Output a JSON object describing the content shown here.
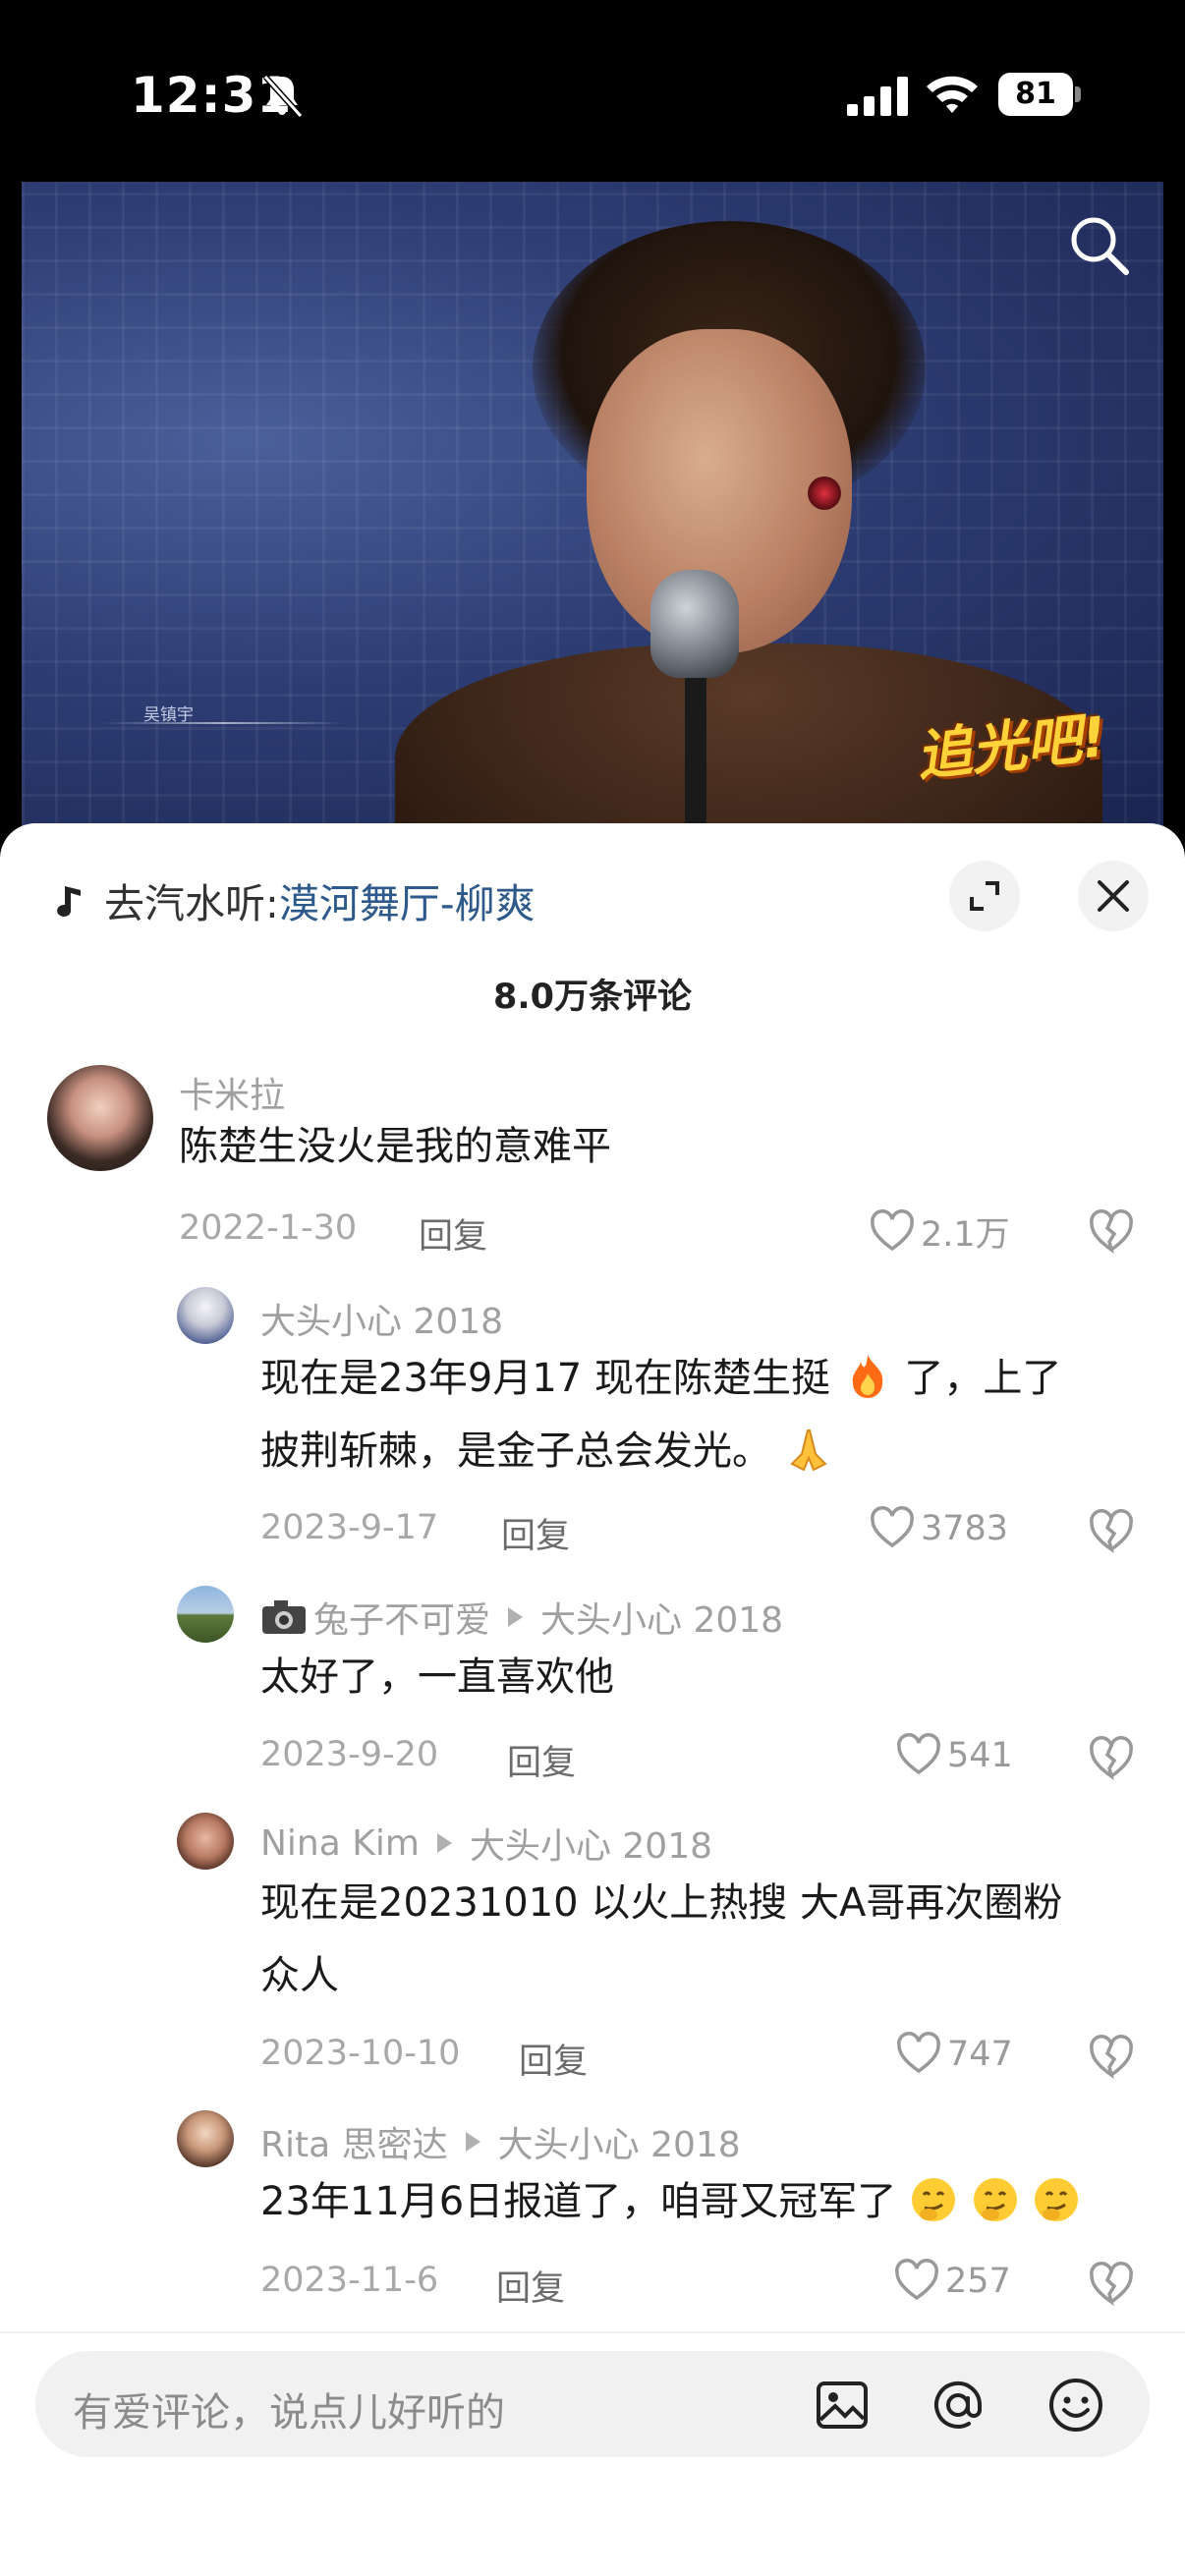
{
  "status_bar": {
    "time": "12:31",
    "battery": "81"
  },
  "video": {
    "name_tag": "吴镇宇",
    "logo_text": "追光吧!"
  },
  "sheet": {
    "music_prefix": "去汽水听:",
    "music_song": "漠河舞厅-柳爽",
    "comment_count": "8.0万条评论"
  },
  "comments": [
    {
      "user": "卡米拉",
      "text_lines": [
        "陈楚生没火是我的意难平"
      ],
      "date": "2022-1-30",
      "reply": "回复",
      "likes": "2.1万"
    },
    {
      "user": "大头小心 2018",
      "text_lines": [
        "现在是23年9月17 现在陈楚生挺",
        "了，上了",
        "披荆斩棘，是金子总会发光。"
      ],
      "date": "2023-9-17",
      "reply": "回复",
      "likes": "3783"
    },
    {
      "user": "兔子不可爱",
      "reply_to": "大头小心 2018",
      "text_lines": [
        "太好了，一直喜欢他"
      ],
      "date": "2023-9-20",
      "reply": "回复",
      "likes": "541"
    },
    {
      "user": "Nina Kim",
      "reply_to": "大头小心 2018",
      "text_lines": [
        "现在是20231010 以火上热搜 大A哥再次圈粉",
        "众人"
      ],
      "date": "2023-10-10",
      "reply": "回复",
      "likes": "747"
    },
    {
      "user": "Rita 思密达",
      "reply_to": "大头小心 2018",
      "text_lines": [
        "23年11月6日报道了，咱哥又冠军了"
      ],
      "date": "2023-11-6",
      "reply": "回复",
      "likes": "257"
    }
  ],
  "input": {
    "placeholder": "有爱评论，说点儿好听的"
  },
  "icons": {
    "bell": "bell-slash-icon",
    "search": "search-icon",
    "expand": "expand-icon",
    "close": "close-icon",
    "heart": "heart-icon",
    "dislike": "broken-heart-icon",
    "image": "image-icon",
    "at": "at-icon",
    "emoji": "emoji-icon"
  }
}
